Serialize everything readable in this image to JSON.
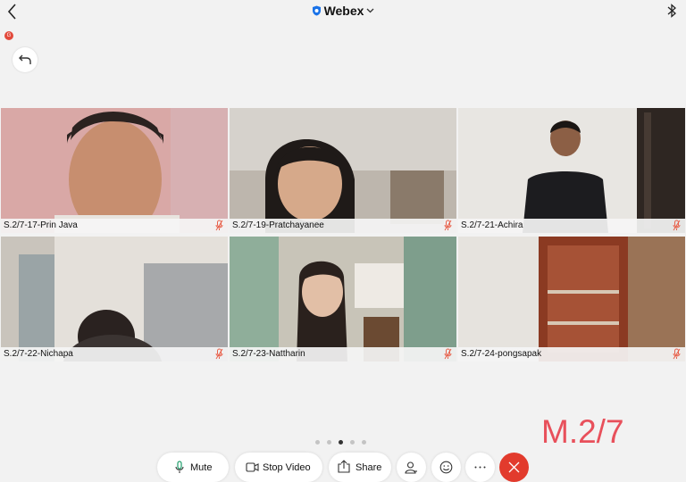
{
  "header": {
    "app_title": "Webex"
  },
  "notification_badge": "G",
  "participants": [
    {
      "name": "S.2/7-17-Prin Java",
      "muted": true
    },
    {
      "name": "S.2/7-19-Pratchayanee",
      "muted": true
    },
    {
      "name": "S.2/7-21-Achira",
      "muted": true
    },
    {
      "name": "S.2/7-22-Nichapa",
      "muted": true
    },
    {
      "name": "S.2/7-23-Nattharin",
      "muted": true
    },
    {
      "name": "S.2/7-24-pongsapak",
      "muted": true
    }
  ],
  "pagination": {
    "pages": 5,
    "current": 3
  },
  "overlay_label": "M.2/7",
  "toolbar": {
    "mute_label": "Mute",
    "stop_video_label": "Stop Video",
    "share_label": "Share"
  },
  "icons": {
    "back": "chevron-left-icon",
    "secure": "shield-icon",
    "bluetooth": "bluetooth-icon",
    "return": "return-arrow-icon",
    "mic": "microphone-icon",
    "mic_off": "microphone-muted-icon",
    "video": "video-camera-icon",
    "share": "share-icon",
    "participants": "participants-icon",
    "reactions": "emoji-icon",
    "more": "more-options-icon",
    "end": "close-icon"
  },
  "colors": {
    "accent_red": "#e8505b",
    "end_call": "#e23b2d",
    "muted_icon": "#e8604a",
    "webex_blue": "#1a73e8"
  }
}
